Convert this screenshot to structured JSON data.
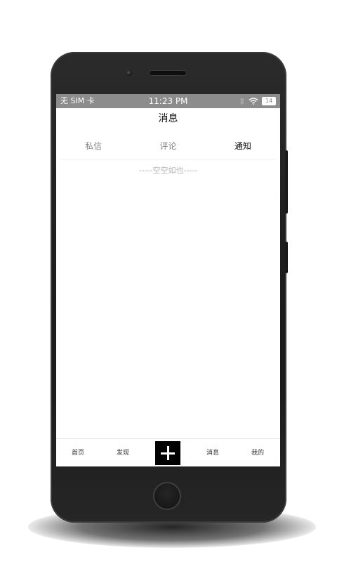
{
  "status_bar": {
    "carrier": "无 SIM 卡",
    "time": "11:23 PM",
    "battery": "14"
  },
  "header": {
    "title": "消息"
  },
  "tabs": [
    {
      "label": "私信",
      "active": false
    },
    {
      "label": "评论",
      "active": false
    },
    {
      "label": "通知",
      "active": true
    }
  ],
  "empty_state": {
    "text": "-----空空如也-----"
  },
  "tabbar": {
    "items": [
      {
        "label": "首页"
      },
      {
        "label": "发现"
      },
      {
        "icon": "plus-icon"
      },
      {
        "label": "消息"
      },
      {
        "label": "我的"
      }
    ]
  },
  "colors": {
    "status_bar_bg": "#8c8c8c",
    "active_text": "#111111",
    "inactive_text": "#888888",
    "plus_button_bg": "#000000"
  }
}
